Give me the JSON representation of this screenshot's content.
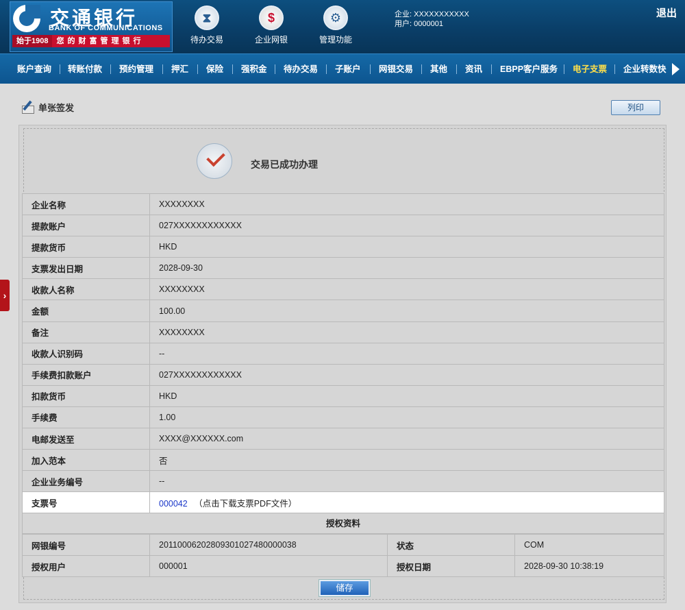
{
  "header": {
    "logo": {
      "cn": "交通银行",
      "en": "BANK OF COMMUNICATIONS",
      "founded": "始于1908",
      "slogan": "您的财富管理银行"
    },
    "top_icons": [
      {
        "label": "待办交易",
        "icon": "hourglass-icon"
      },
      {
        "label": "企业网银",
        "icon": "monitor-icon"
      },
      {
        "label": "管理功能",
        "icon": "gears-icon"
      }
    ],
    "user": {
      "company_line": "企业: XXXXXXXXXXX",
      "user_line": "用户: 0000001"
    },
    "logout": "退出"
  },
  "nav": {
    "items": [
      "账户查询",
      "转账付款",
      "预约管理",
      "押汇",
      "保险",
      "强积金",
      "待办交易",
      "子账户",
      "网银交易",
      "其他",
      "资讯",
      "EBPP客户服务",
      "电子支票",
      "企业转数快"
    ],
    "active": "电子支票"
  },
  "page": {
    "title": "单张签发",
    "print_label": "列印",
    "side_tab": "›"
  },
  "result": {
    "message": "交易已成功办理"
  },
  "details": [
    {
      "label": "企业名称",
      "value": "XXXXXXXX"
    },
    {
      "label": "提款账户",
      "value": "027XXXXXXXXXXXX"
    },
    {
      "label": "提款货币",
      "value": "HKD"
    },
    {
      "label": "支票发出日期",
      "value": "2028-09-30"
    },
    {
      "label": "收款人名称",
      "value": "XXXXXXXX"
    },
    {
      "label": "金额",
      "value": "100.00"
    },
    {
      "label": "备注",
      "value": "XXXXXXXX"
    },
    {
      "label": "收款人识别码",
      "value": "--"
    },
    {
      "label": "手续费扣款账户",
      "value": "027XXXXXXXXXXXX"
    },
    {
      "label": "扣款货币",
      "value": "HKD"
    },
    {
      "label": "手续费",
      "value": "1.00"
    },
    {
      "label": "电邮发送至",
      "value": "XXXX@XXXXXX.com"
    },
    {
      "label": "加入范本",
      "value": "否"
    },
    {
      "label": "企业业务编号",
      "value": "--"
    }
  ],
  "cheque": {
    "label": "支票号",
    "number": "000042",
    "hint": "（点击下载支票PDF文件）"
  },
  "auth": {
    "title": "授权资料",
    "ref_label": "网银编号",
    "ref_value": "20110006202809301027480000038",
    "status_label": "状态",
    "status_value": "COM",
    "user_label": "授权用户",
    "user_value": "000001",
    "date_label": "授权日期",
    "date_value": "2028-09-30 10:38:19"
  },
  "save_label": "储存"
}
